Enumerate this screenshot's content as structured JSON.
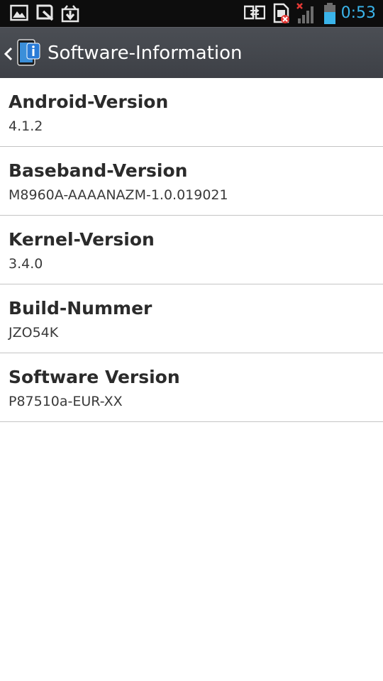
{
  "status_bar": {
    "time": "0:53",
    "time_color": "#3ab4ea",
    "icons": [
      "image-icon",
      "quick-memo-icon",
      "download-icon",
      "transfer-icon",
      "no-sim-icon",
      "no-signal-icon",
      "battery-icon"
    ]
  },
  "action_bar": {
    "title": "Software-Information",
    "back_icon": "chevron-left-icon",
    "app_icon": "info-icon"
  },
  "items": [
    {
      "title": "Android-Version",
      "value": "4.1.2"
    },
    {
      "title": "Baseband-Version",
      "value": "M8960A-AAAANAZM-1.0.019021"
    },
    {
      "title": "Kernel-Version",
      "value": "3.4.0"
    },
    {
      "title": "Build-Nummer",
      "value": "JZO54K"
    },
    {
      "title": "Software Version",
      "value": "P87510a-EUR-XX"
    }
  ]
}
